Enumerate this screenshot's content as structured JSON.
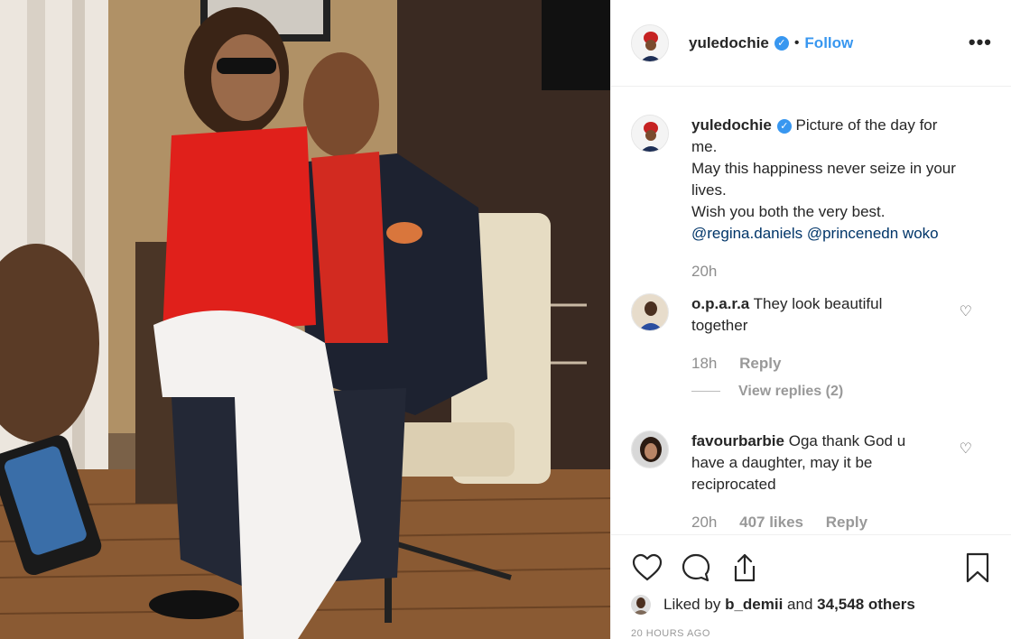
{
  "post": {
    "author": "yuledochie",
    "follow_label": "Follow",
    "separator": "•",
    "more_label": "•••"
  },
  "caption": {
    "author": "yuledochie",
    "lines": [
      "Picture of the day for",
      "me.",
      "May this happiness never seize in your",
      "lives.",
      "Wish you both the very best.",
      "@regina.daniels @princenedn woko"
    ],
    "time": "20h"
  },
  "comments": [
    {
      "author": "o.p.a.r.a",
      "lines": [
        "They look beautiful",
        "together"
      ],
      "time": "18h",
      "reply_label": "Reply",
      "view_replies": "View replies (2)"
    },
    {
      "author": "favourbarbie",
      "lines": [
        "Oga thank God u",
        "have a daughter, may it be",
        "reciprocated"
      ],
      "time": "20h",
      "likes": "407 likes",
      "reply_label": "Reply"
    }
  ],
  "likes": {
    "prefix": "Liked by ",
    "user": "b_demii",
    "middle": " and ",
    "count": "34,548 others"
  },
  "timestamp": "20 HOURS AGO",
  "icons": [
    "heart-icon",
    "comment-icon",
    "share-icon",
    "bookmark-icon",
    "verified-badge-icon",
    "more-options-icon"
  ],
  "colors": {
    "link": "#3897f0",
    "verified": "#3897f0",
    "muted": "#999999",
    "text": "#262626"
  }
}
